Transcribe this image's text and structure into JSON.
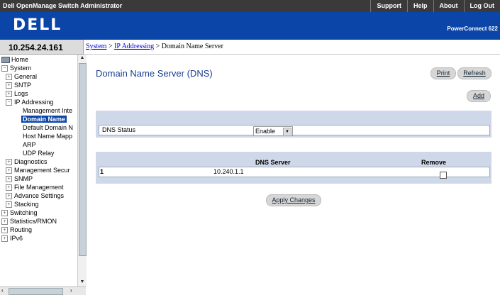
{
  "topbar": {
    "title": "Dell OpenManage Switch Administrator",
    "links": [
      "Support",
      "Help",
      "About",
      "Log Out"
    ]
  },
  "header": {
    "logo": "DELL",
    "product": "PowerConnect 622"
  },
  "ip": "10.254.24.161",
  "breadcrumb": {
    "system": "System",
    "sep1": " > ",
    "ip_addressing": "IP Addressing",
    "sep2": " > ",
    "current": "Domain Name Server"
  },
  "tree": [
    {
      "label": "Home",
      "icon": "home-icon"
    },
    {
      "label": "System",
      "exp": "−"
    },
    {
      "label": "General",
      "exp": "+"
    },
    {
      "label": "SNTP",
      "exp": "+"
    },
    {
      "label": "Logs",
      "exp": "+"
    },
    {
      "label": "IP Addressing",
      "exp": "−"
    },
    {
      "label": "Management Inte"
    },
    {
      "label": "Domain Name",
      "selected": true
    },
    {
      "label": "Default Domain N"
    },
    {
      "label": "Host Name Mapp"
    },
    {
      "label": "ARP"
    },
    {
      "label": "UDP Relay"
    },
    {
      "label": "Diagnostics",
      "exp": "+"
    },
    {
      "label": "Management Secur",
      "exp": "+"
    },
    {
      "label": "SNMP",
      "exp": "+"
    },
    {
      "label": "File Management",
      "exp": "+"
    },
    {
      "label": "Advance Settings",
      "exp": "+"
    },
    {
      "label": "Stacking",
      "exp": "+"
    },
    {
      "label": "Switching",
      "exp": "+"
    },
    {
      "label": "Statistics/RMON",
      "exp": "+"
    },
    {
      "label": "Routing",
      "exp": "+"
    },
    {
      "label": "IPv6",
      "exp": "+"
    }
  ],
  "main": {
    "title": "Domain Name Server (DNS)",
    "print": "Print",
    "refresh": "Refresh",
    "add": "Add",
    "dns_status_label": "DNS Status",
    "dns_status_value": "Enable",
    "table": {
      "col_server": "DNS Server",
      "col_remove": "Remove",
      "rows": [
        {
          "index": "1",
          "server": "10.240.1.1",
          "remove": false
        }
      ]
    },
    "apply": "Apply Changes"
  }
}
